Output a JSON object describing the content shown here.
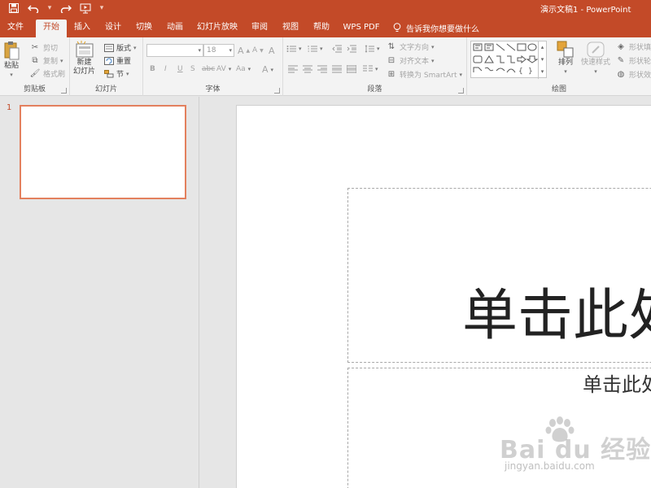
{
  "window": {
    "title": "演示文稿1  -  PowerPoint"
  },
  "qat": {
    "save": "save-icon",
    "undo": "undo-icon",
    "redo": "redo-icon",
    "start": "start-from-beginning-icon",
    "customize": "▾"
  },
  "tabs": [
    {
      "label": "文件"
    },
    {
      "label": "开始"
    },
    {
      "label": "插入"
    },
    {
      "label": "设计"
    },
    {
      "label": "切换"
    },
    {
      "label": "动画"
    },
    {
      "label": "幻灯片放映"
    },
    {
      "label": "审阅"
    },
    {
      "label": "视图"
    },
    {
      "label": "帮助"
    },
    {
      "label": "WPS PDF"
    }
  ],
  "tell_me": "告诉我你想要做什么",
  "ribbon": {
    "clipboard": {
      "label": "剪贴板",
      "paste": "粘贴",
      "cut": "剪切",
      "copy": "复制",
      "format_painter": "格式刷"
    },
    "slides": {
      "label": "幻灯片",
      "new_slide": "新建",
      "new_slide_2": "幻灯片",
      "layout": "版式",
      "reset": "重置",
      "section": "节"
    },
    "font": {
      "label": "字体",
      "font_name": "",
      "font_size": "18",
      "bold": "B",
      "italic": "I",
      "underline": "U",
      "shadow": "S",
      "strike": "abc",
      "spacing": "AV",
      "case": "Aa",
      "font_color": "A",
      "grow": "A",
      "shrink": "A",
      "clear": "A"
    },
    "paragraph": {
      "label": "段落",
      "text_direction": "文字方向",
      "align_text": "对齐文本",
      "smartart": "转换为 SmartArt"
    },
    "drawing": {
      "label": "绘图",
      "arrange": "排列",
      "quick_styles": "快速样式",
      "shape_fill": "形状填充",
      "shape_outline": "形状轮廓",
      "shape_effects": "形状效果"
    }
  },
  "thumbnails": [
    {
      "number": "1"
    }
  ],
  "slide": {
    "title_placeholder": "单击此处添加标题",
    "subtitle_placeholder": "单击此处添加副标题"
  },
  "watermark": {
    "main": "Bai du 经验",
    "url": "jingyan.baidu.com"
  }
}
